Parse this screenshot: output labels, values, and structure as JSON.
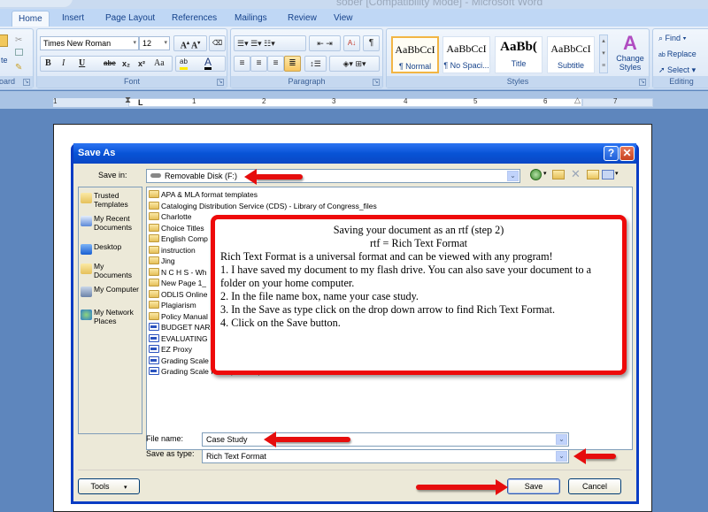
{
  "window": {
    "title": "sober [Compatibility Mode] - Microsoft Word"
  },
  "ribbon": {
    "tabs": [
      "Home",
      "Insert",
      "Page Layout",
      "References",
      "Mailings",
      "Review",
      "View"
    ],
    "active_tab": "Home",
    "clipboard": {
      "label": "Clipboard",
      "paste_label": "Paste",
      "label_visible": "oard",
      "paste_visible": "te"
    },
    "font": {
      "label": "Font",
      "font_name": "Times New Roman",
      "font_size": "12",
      "buttons": [
        "B",
        "I",
        "U",
        "abe",
        "x₂",
        "x²",
        "Aa",
        "ab",
        "A"
      ]
    },
    "paragraph": {
      "label": "Paragraph"
    },
    "styles": {
      "label": "Styles",
      "items": [
        {
          "preview": "AaBbCcI",
          "name": "¶ Normal"
        },
        {
          "preview": "AaBbCcI",
          "name": "¶ No Spaci..."
        },
        {
          "preview": "AaBb(",
          "name": "Title"
        },
        {
          "preview": "AaBbCcI",
          "name": "Subtitle"
        }
      ],
      "change_styles": "Change Styles"
    },
    "editing": {
      "label": "Editing",
      "find": "Find",
      "replace": "Replace",
      "select": "Select"
    }
  },
  "ruler": {
    "numbers": [
      "1",
      "1",
      "2",
      "3",
      "4",
      "5",
      "6",
      "7"
    ]
  },
  "dialog": {
    "title": "Save As",
    "help": "?",
    "close": "✕",
    "save_in_label": "Save in:",
    "save_in_value": "Removable Disk (F:)",
    "places": [
      "Trusted Templates",
      "My Recent Documents",
      "Desktop",
      "My Documents",
      "My Computer",
      "My Network Places"
    ],
    "files": [
      {
        "name": "APA & MLA format templates",
        "type": "folder"
      },
      {
        "name": "Cataloging Distribution Service (CDS) - Library of Congress_files",
        "type": "folder"
      },
      {
        "name": "Charlotte",
        "type": "folder"
      },
      {
        "name": "Choice Titles",
        "type": "folder"
      },
      {
        "name": "English Comp",
        "type": "folder"
      },
      {
        "name": "instruction",
        "type": "folder"
      },
      {
        "name": "Jing",
        "type": "folder"
      },
      {
        "name": "N C H S - Wh",
        "type": "folder"
      },
      {
        "name": "New Page 1_",
        "type": "folder"
      },
      {
        "name": "ODLIS Online",
        "type": "folder"
      },
      {
        "name": "Plagiarism",
        "type": "folder"
      },
      {
        "name": "Policy Manual",
        "type": "folder"
      },
      {
        "name": "BUDGET NAR",
        "type": "doc"
      },
      {
        "name": "EVALUATING",
        "type": "doc"
      },
      {
        "name": "EZ Proxy",
        "type": "doc"
      },
      {
        "name": "Grading Scale for  any paper",
        "type": "doc"
      },
      {
        "name": "Grading Scale for Paper  Template",
        "type": "doc"
      }
    ],
    "file_name_label": "File name:",
    "file_name_value": "Case Study",
    "save_as_type_label": "Save as type:",
    "save_as_type_value": "Rich Text Format",
    "tools_label": "Tools",
    "save_label": "Save",
    "cancel_label": "Cancel"
  },
  "callout": {
    "title": "Saving your document as an rtf (step 2)",
    "subtitle": "rtf = Rich Text Format",
    "lines": [
      "Rich Text Format is a universal format and can be viewed with any program!",
      "1. I have saved my document to my flash drive. You can also save your document to a folder on your home computer.",
      "2. In the file name box, name your case study.",
      "3. In the Save as type click on the drop down arrow to find Rich Text Format.",
      "4. Click on the Save button."
    ]
  }
}
